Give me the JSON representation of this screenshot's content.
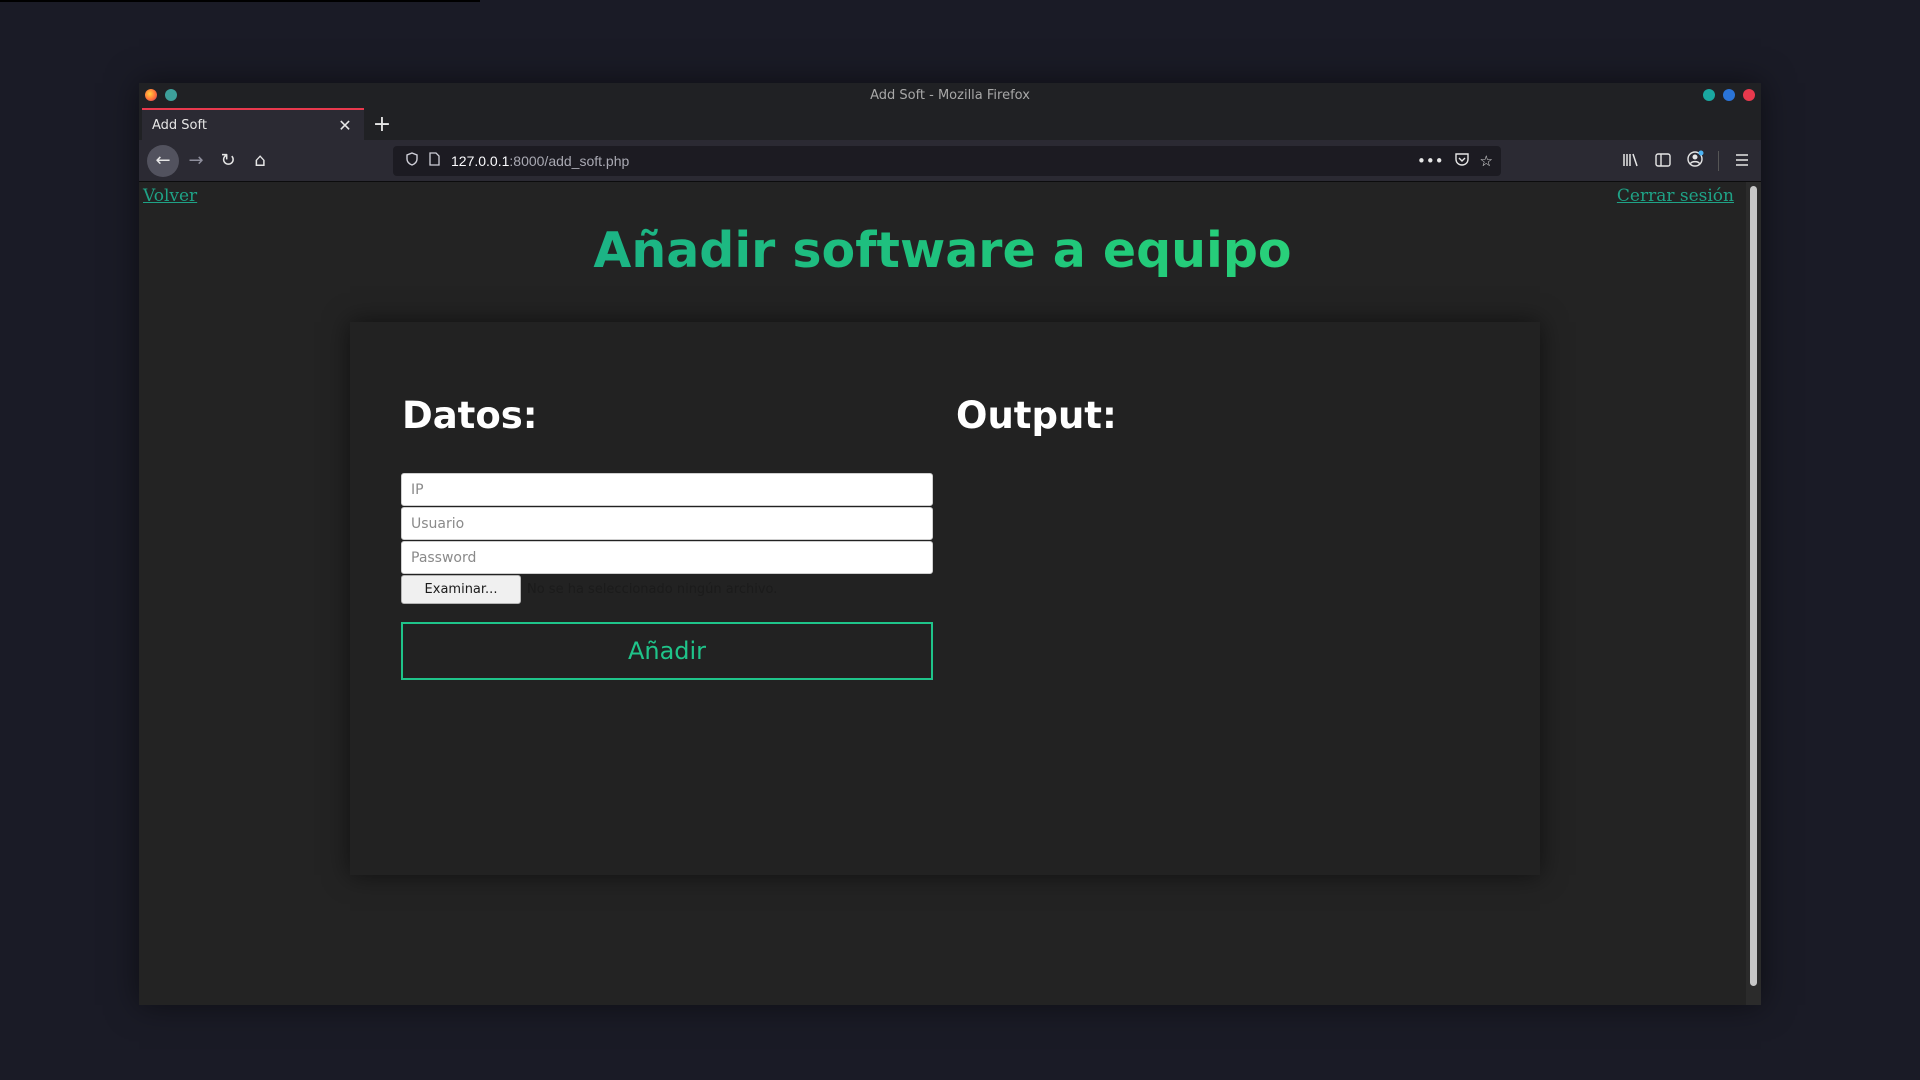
{
  "window": {
    "title": "Add Soft - Mozilla Firefox"
  },
  "tab": {
    "title": "Add Soft",
    "close": "✕",
    "new": "+"
  },
  "nav": {
    "back": "←",
    "forward": "→",
    "reload": "↻",
    "home": "⌂"
  },
  "url": {
    "host": "127.0.0.1",
    "rest": ":8000/add_soft.php"
  },
  "page": {
    "back_link": "Volver",
    "logout_link": "Cerrar sesión",
    "title": "Añadir software a equipo",
    "datos_heading": "Datos:",
    "output_heading": "Output:",
    "ip_placeholder": "IP",
    "user_placeholder": "Usuario",
    "password_placeholder": "Password",
    "file_button": "Examinar...",
    "file_status": "No se ha seleccionado ningún archivo.",
    "submit": "Añadir"
  },
  "colors": {
    "accent": "#1fc48a",
    "link": "#1fa286",
    "tab_highlight": "#e8394d"
  }
}
